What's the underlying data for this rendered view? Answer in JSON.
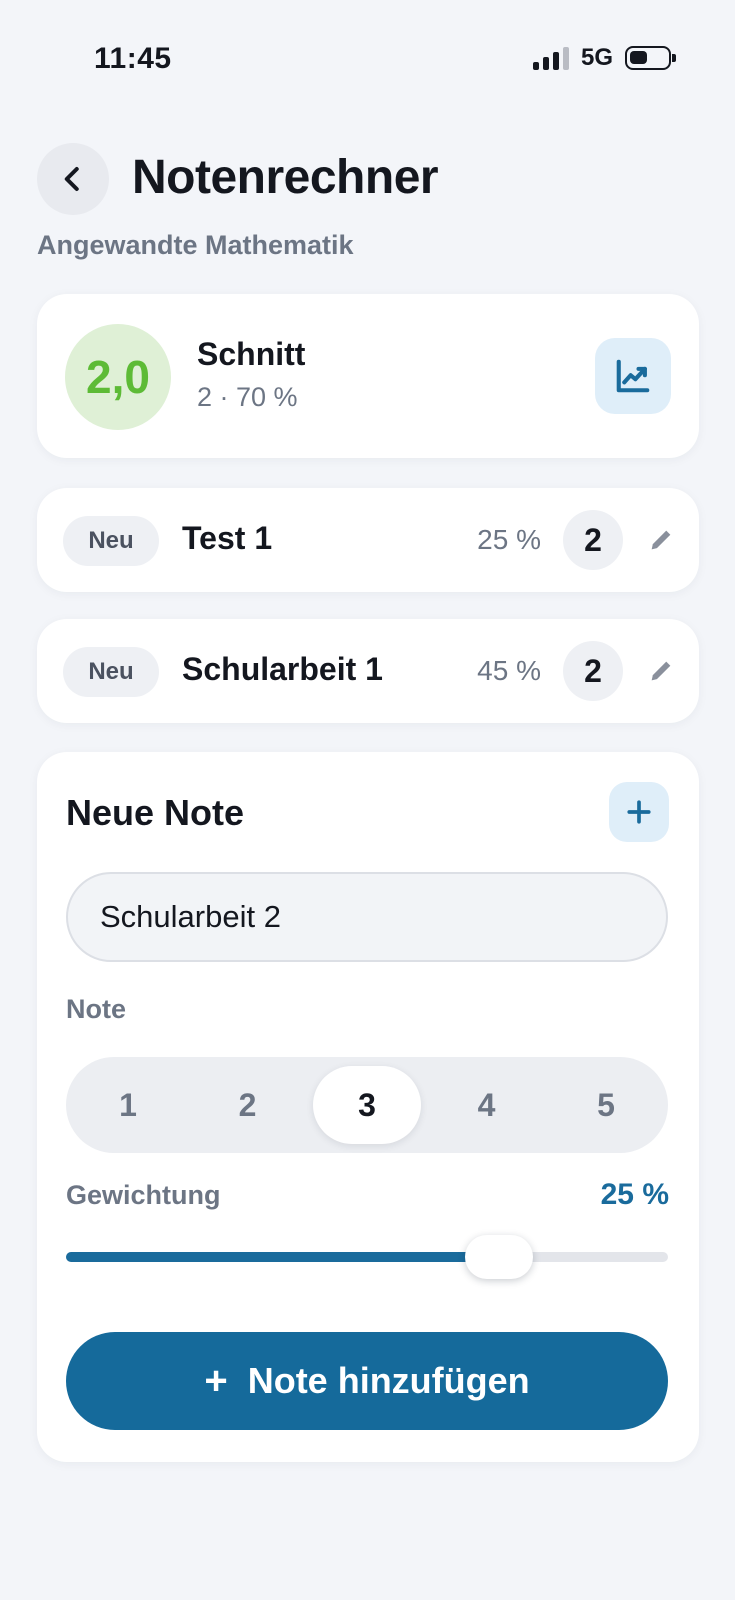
{
  "status_bar": {
    "time": "11:45",
    "network": "5G"
  },
  "header": {
    "title": "Notenrechner",
    "subtitle": "Angewandte Mathematik",
    "back_icon": "chevron-left-icon"
  },
  "summary": {
    "average": "2,0",
    "label": "Schnitt",
    "detail": "2 · 70 %",
    "chart_icon": "trending-chart-icon",
    "average_color": "#5dbb36"
  },
  "grades": [
    {
      "badge": "Neu",
      "name": "Test 1",
      "weight": "25 %",
      "grade": "2"
    },
    {
      "badge": "Neu",
      "name": "Schularbeit 1",
      "weight": "45 %",
      "grade": "2"
    }
  ],
  "new_grade": {
    "title": "Neue Note",
    "name_value": "Schularbeit 2",
    "grade_label": "Note",
    "grade_options": [
      "1",
      "2",
      "3",
      "4",
      "5"
    ],
    "selected_grade": "3",
    "weight_label": "Gewichtung",
    "weight_value": "25 %",
    "slider_fraction": 0.72,
    "add_button_label": "Note hinzufügen",
    "add_button_icon": "+"
  },
  "colors": {
    "accent": "#1a6b9c",
    "background": "#f3f5f9"
  }
}
